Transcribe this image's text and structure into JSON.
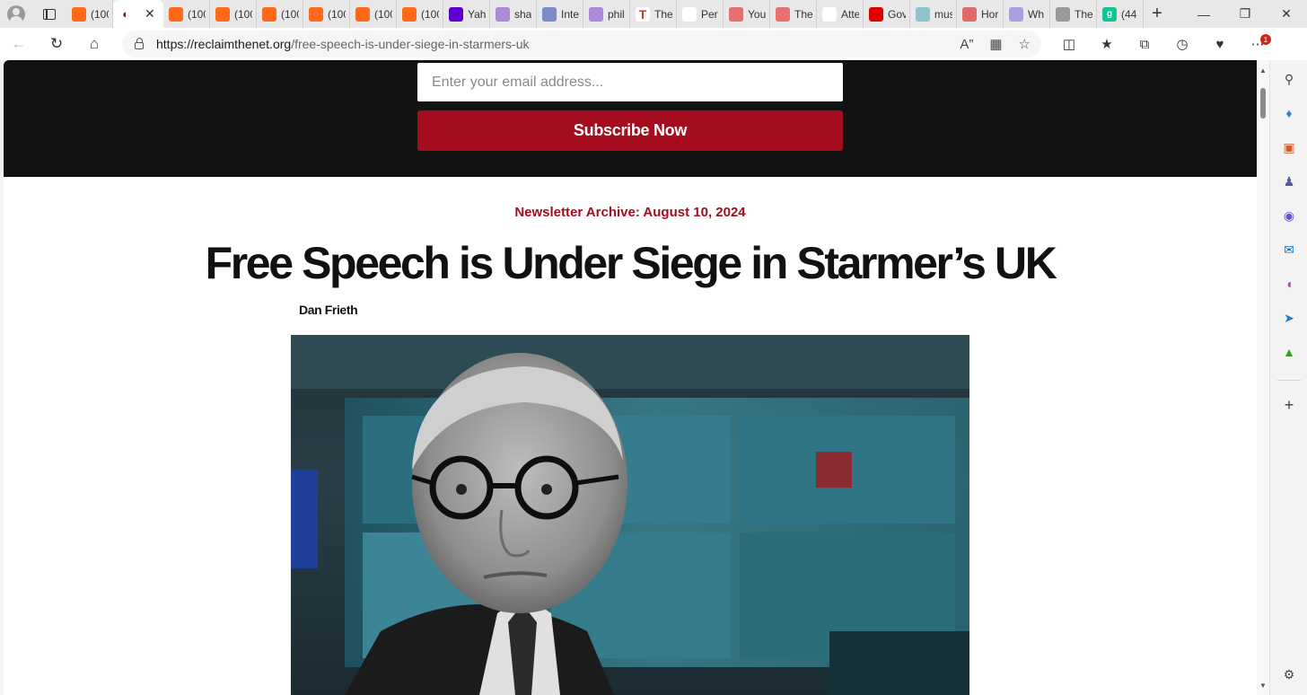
{
  "browser": {
    "tabs": [
      {
        "title": "(100",
        "favicon": "substack-icon",
        "color": "#ff6719"
      },
      {
        "title": "",
        "favicon": "reclaimthenet-icon",
        "color": "#ffffff",
        "active": true
      },
      {
        "title": "(100",
        "favicon": "substack-icon",
        "color": "#ff6719"
      },
      {
        "title": "(100",
        "favicon": "substack-icon",
        "color": "#ff6719"
      },
      {
        "title": "(100",
        "favicon": "substack-icon",
        "color": "#ff6719"
      },
      {
        "title": "(100",
        "favicon": "substack-icon",
        "color": "#ff6719"
      },
      {
        "title": "(100",
        "favicon": "substack-icon",
        "color": "#ff6719"
      },
      {
        "title": "(100",
        "favicon": "substack-icon",
        "color": "#ff6719"
      },
      {
        "title": "Yah",
        "favicon": "yahoo-icon",
        "color": "#5f01d1"
      },
      {
        "title": "sha",
        "favicon": "yahoo-icon",
        "color": "#a98bd8"
      },
      {
        "title": "Inte",
        "favicon": "document-icon",
        "color": "#7b8cc7"
      },
      {
        "title": "phil",
        "favicon": "yahoo-icon",
        "color": "#a98bd8"
      },
      {
        "title": "The",
        "favicon": "letter-t-icon",
        "color": "#ffffff"
      },
      {
        "title": "Per",
        "favicon": "globe-icon",
        "color": "#ffffff"
      },
      {
        "title": "You",
        "favicon": "youtube-icon",
        "color": "#e76f6f"
      },
      {
        "title": "The",
        "favicon": "youtube-icon",
        "color": "#e76f6f"
      },
      {
        "title": "Atte",
        "favicon": "page-icon",
        "color": "#ffffff"
      },
      {
        "title": "Gov",
        "favicon": "youtube-icon",
        "color": "#e00000"
      },
      {
        "title": "mus",
        "favicon": "image-icon",
        "color": "#8fc3c8"
      },
      {
        "title": "Hor",
        "favicon": "podcast-icon",
        "color": "#e06b6b"
      },
      {
        "title": "Wh",
        "favicon": "shield-icon",
        "color": "#a9a0e0"
      },
      {
        "title": "The",
        "favicon": "dots-icon",
        "color": "#9a9a9a"
      },
      {
        "title": "(44",
        "favicon": "grammarly-icon",
        "color": "#15c39a"
      }
    ],
    "url_host": "https://reclaimthenet.org",
    "url_path": "/free-speech-is-under-siege-in-starmers-uk",
    "notification_count": "1"
  },
  "page": {
    "email_placeholder": "Enter your email address...",
    "subscribe_label": "Subscribe Now",
    "archive_label": "Newsletter Archive: August 10, 2024",
    "title": "Free Speech is Under Siege in Starmer’s UK",
    "author": "Dan Frieth"
  },
  "colors": {
    "accent": "#a50d1e",
    "band": "#121212"
  }
}
